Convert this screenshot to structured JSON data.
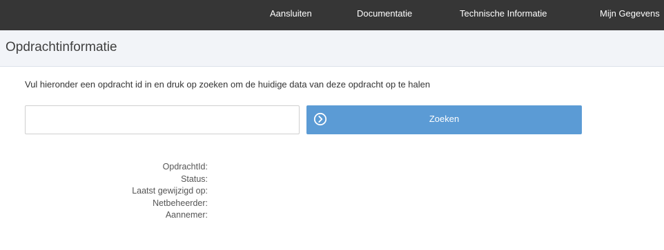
{
  "nav": {
    "items": [
      {
        "label": "Aansluiten"
      },
      {
        "label": "Documentatie"
      },
      {
        "label": "Technische Informatie"
      },
      {
        "label": "Mijn Gegevens"
      }
    ]
  },
  "header": {
    "title": "Opdrachtinformatie"
  },
  "main": {
    "instruction": "Vul hieronder een opdracht id in en druk op zoeken om de huidige data van deze opdracht op te halen",
    "search_value": "",
    "search_button_label": "Zoeken",
    "search_button_icon": "chevron-right-circle-icon",
    "fields": [
      {
        "label": "OpdrachtId:"
      },
      {
        "label": "Status:"
      },
      {
        "label": "Laatst gewijzigd op:"
      },
      {
        "label": "Netbeheerder:"
      },
      {
        "label": "Aannemer:"
      }
    ]
  },
  "colors": {
    "topbar": "#363636",
    "header_bg": "#f2f4f8",
    "button": "#5b9bd5"
  }
}
